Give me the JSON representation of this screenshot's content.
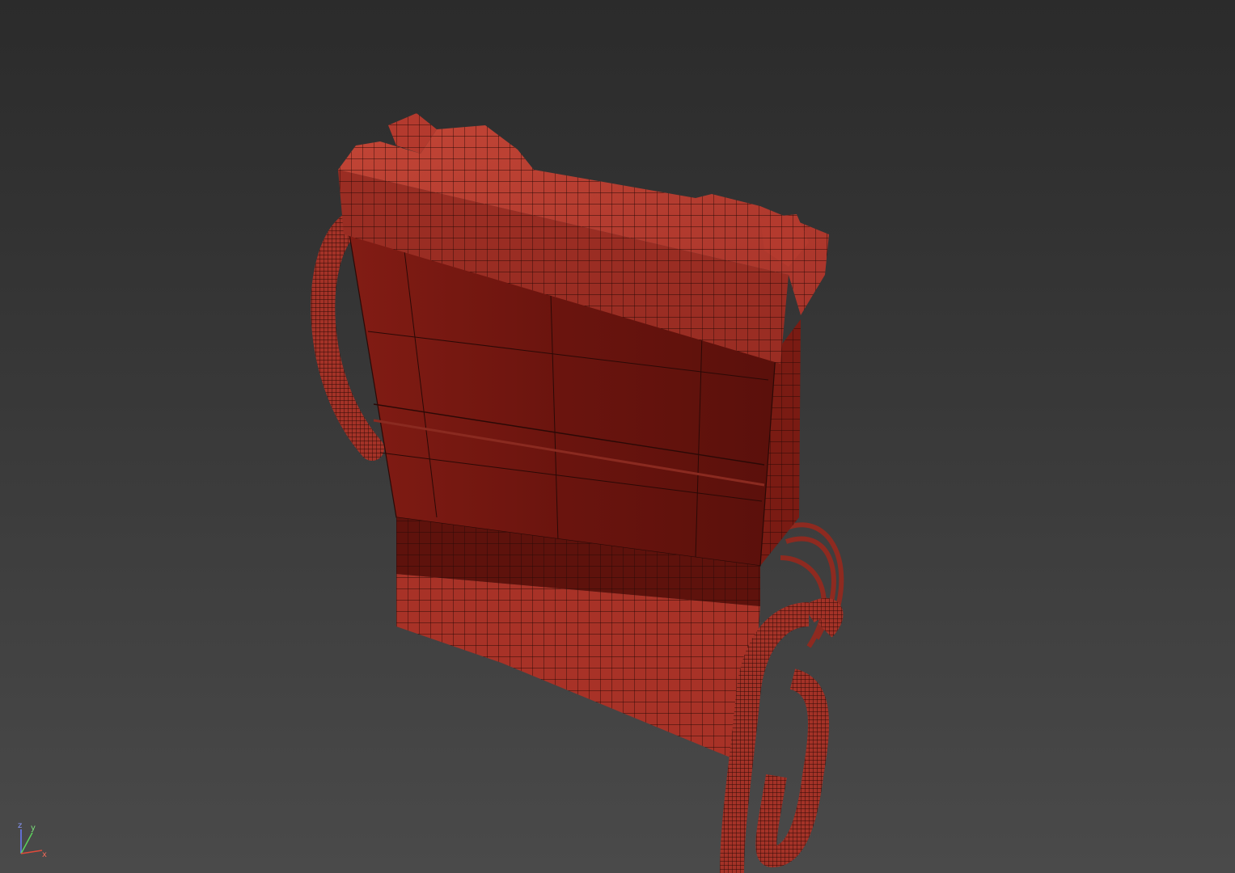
{
  "viewport": {
    "background_top": "#2b2b2b",
    "background_bottom": "#4a4a4a"
  },
  "model": {
    "object": "backpack-wireframe-model",
    "body_color": "#6b150f",
    "face_color": "#b2382c",
    "wire_color": "#2a0906"
  },
  "axis_gizmo": {
    "z_label": "z",
    "y_label": "y",
    "x_label": "x",
    "z_color": "#6a7cff",
    "y_color": "#5bd35b",
    "x_color": "#e04a3a"
  }
}
